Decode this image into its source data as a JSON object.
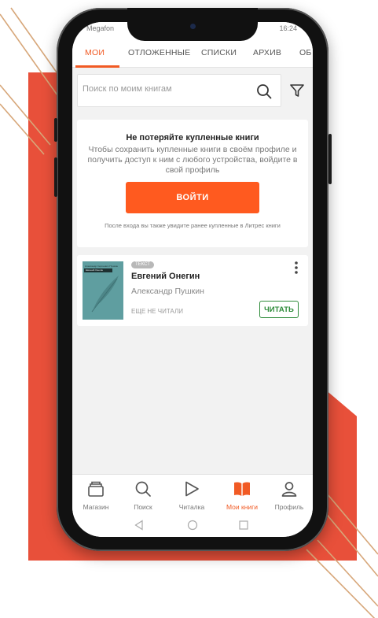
{
  "statusbar": {
    "carrier": "Megafon",
    "clock": "16:24"
  },
  "tabs": [
    {
      "label": "МОИ",
      "active": true
    },
    {
      "label": "ОТЛОЖЕННЫЕ",
      "active": false
    },
    {
      "label": "СПИСКИ",
      "active": false
    },
    {
      "label": "АРХИВ",
      "active": false
    },
    {
      "label": "ОБ",
      "active": false
    }
  ],
  "search": {
    "placeholder": "Поиск по моим книгам",
    "icon": "search-icon",
    "filter_icon": "filter-icon"
  },
  "promo": {
    "title": "Не потеряйте купленные книги",
    "text": "Чтобы сохранить купленные книги в своём профиле и получить доступ к ним с любого устройства, войдите в свой профиль",
    "button_label": "ВОЙТИ",
    "note": "После входа вы также увидите ранее купленные в Литрес книги"
  },
  "book": {
    "badge": "ТЕКСТ",
    "title": "Евгений Онегин",
    "author": "Александр Пушкин",
    "status": "ЕЩЕ НЕ ЧИТАЛИ",
    "read_button": "ЧИТАТЬ",
    "cover": {
      "author": "Александр Сергеевич Пушкин",
      "title": "Евгений Онегин",
      "color": "#5f9ea0"
    }
  },
  "bottom_nav": [
    {
      "label": "Магазин",
      "icon": "store-icon",
      "active": false
    },
    {
      "label": "Поиск",
      "icon": "search-icon",
      "active": false
    },
    {
      "label": "Читалка",
      "icon": "play-icon",
      "active": false
    },
    {
      "label": "Мои книги",
      "icon": "book-icon",
      "active": true
    },
    {
      "label": "Профиль",
      "icon": "profile-icon",
      "active": false
    }
  ],
  "colors": {
    "accent": "#f15a24",
    "login_button": "#ff5a1f",
    "read_button": "#2e8b3a",
    "background_shape": "#e8503a"
  }
}
